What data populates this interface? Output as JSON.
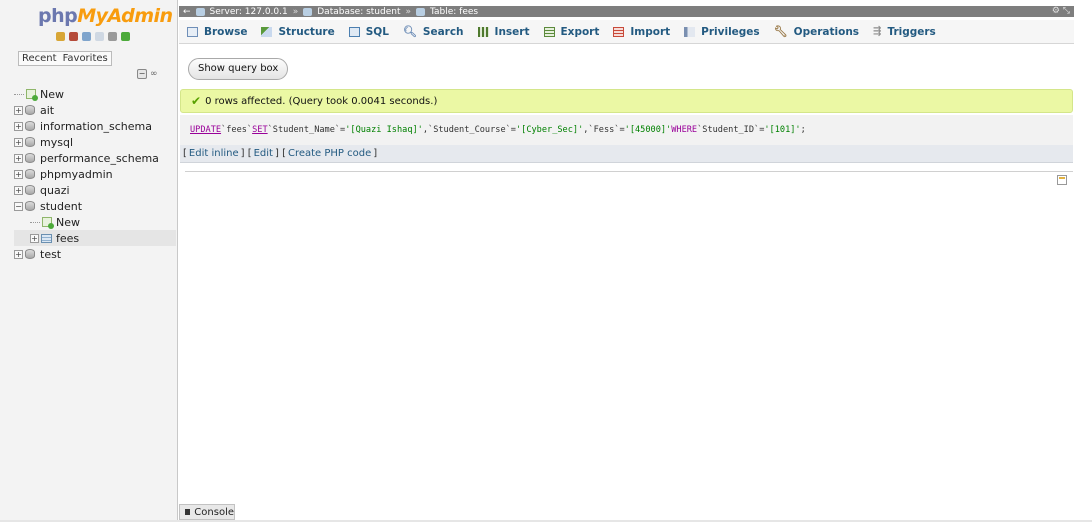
{
  "logo": {
    "part1": "php",
    "part2": "MyAdmin"
  },
  "navigation": {
    "recent_tab": "Recent",
    "favorites_tab": "Favorites",
    "tree": [
      {
        "label": "New",
        "type": "new",
        "level": 0
      },
      {
        "label": "ait",
        "type": "db",
        "level": 0
      },
      {
        "label": "information_schema",
        "type": "db",
        "level": 0
      },
      {
        "label": "mysql",
        "type": "db",
        "level": 0
      },
      {
        "label": "performance_schema",
        "type": "db",
        "level": 0
      },
      {
        "label": "phpmyadmin",
        "type": "db",
        "level": 0
      },
      {
        "label": "quazi",
        "type": "db",
        "level": 0
      },
      {
        "label": "student",
        "type": "db",
        "level": 0,
        "expanded": true
      },
      {
        "label": "New",
        "type": "new",
        "level": 1
      },
      {
        "label": "fees",
        "type": "table",
        "level": 1,
        "selected": true
      },
      {
        "label": "test",
        "type": "db",
        "level": 0
      }
    ]
  },
  "breadcrumb": {
    "server": "Server: 127.0.0.1",
    "database": "Database: student",
    "table": "Table: fees"
  },
  "tabs": [
    {
      "label": "Browse",
      "icon": "browse-icon",
      "color": "#6f8fb8"
    },
    {
      "label": "Structure",
      "icon": "structure-icon",
      "color": "#5a9a3b"
    },
    {
      "label": "SQL",
      "icon": "sql-icon",
      "color": "#4c7fb0"
    },
    {
      "label": "Search",
      "icon": "search-icon",
      "color": "#8aa6c4"
    },
    {
      "label": "Insert",
      "icon": "insert-icon",
      "color": "#4f7a2e"
    },
    {
      "label": "Export",
      "icon": "export-icon",
      "color": "#5c8a3c"
    },
    {
      "label": "Import",
      "icon": "import-icon",
      "color": "#c84a3a"
    },
    {
      "label": "Privileges",
      "icon": "privileges-icon",
      "color": "#7a8fb0"
    },
    {
      "label": "Operations",
      "icon": "operations-icon",
      "color": "#9a7a4a"
    },
    {
      "label": "Triggers",
      "icon": "triggers-icon",
      "color": "#8e8e8e"
    }
  ],
  "main": {
    "show_query_button": "Show query box",
    "success_message": "0 rows affected. (Query took 0.0041 seconds.)",
    "sql": {
      "update_kw": "UPDATE",
      "part1": " `fees` ",
      "set_kw": "SET",
      "part2": " `Student_Name`=",
      "val1": "'[Quazi Ishaq]'",
      "part3": ",`Student_Course`=",
      "val2": "'[Cyber_Sec]'",
      "part4": ",`Fess`=",
      "val3": "'[45000]'",
      "where_kw": " WHERE ",
      "part5": "`Student_ID`=",
      "val4": "'[101]'",
      "end": ";"
    },
    "links": {
      "edit_inline": "Edit inline",
      "edit": "Edit",
      "create_php": "Create PHP code"
    }
  },
  "console": {
    "label": "Console"
  },
  "colors": {
    "success_bg": "#ebf8a4",
    "link": "#235a81",
    "topbar": "#7e7e7e"
  }
}
